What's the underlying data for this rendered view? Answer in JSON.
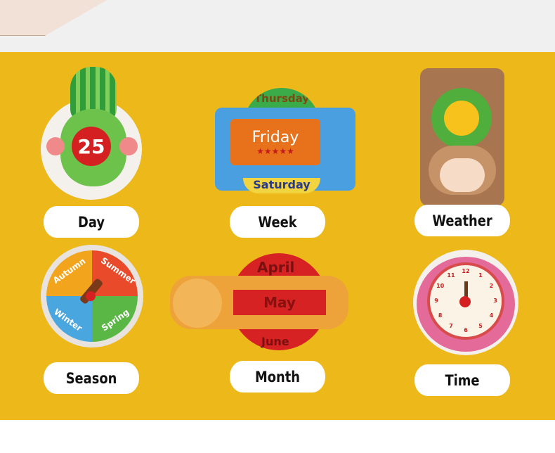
{
  "labels": [
    "Day",
    "Week",
    "Weather",
    "Season",
    "Month",
    "Time"
  ],
  "day": {
    "number": "25"
  },
  "week": {
    "current": "Friday",
    "previous": "Thursday",
    "next": "Saturday",
    "stars": "★★★★★"
  },
  "season": {
    "segments": [
      "Autumn",
      "Summer",
      "Winter",
      "Spring"
    ]
  },
  "month": {
    "previous": "April",
    "current": "May",
    "next": "June"
  },
  "time": {
    "numbers": [
      "12",
      "1",
      "2",
      "3",
      "4",
      "5",
      "6",
      "7",
      "8",
      "9",
      "10",
      "11"
    ]
  },
  "colors": {
    "background_band": "#ecb81a",
    "label_pill": "#ffffff"
  }
}
